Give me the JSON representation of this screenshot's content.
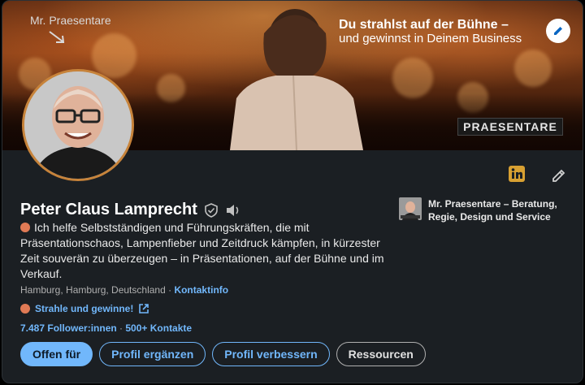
{
  "banner": {
    "brand_caption": "Mr. Praesentare",
    "headline": "Du strahlst auf der Bühne –",
    "subline": "und gewinnst in Deinem Business",
    "logo_text": "PRAESENTARE"
  },
  "profile": {
    "name": "Peter Claus Lamprecht",
    "headline": "Ich helfe Selbstständigen und Führungskräften, die mit Präsentationschaos, Lampenfieber und Zeitdruck kämpfen, in kürzester Zeit souverän zu überzeugen – in Präsentationen, auf der Bühne und im Verkauf.",
    "location": "Hamburg, Hamburg, Deutschland",
    "separator": " · ",
    "contact_link": "Kontaktinfo",
    "promo_link": "Strahle und gewinne!",
    "followers": "7.487 Follower:innen",
    "stats_separator": " · ",
    "connections": "500+ Kontakte"
  },
  "company": {
    "name": "Mr. Praesentare – Beratung, Regie, Design und Service"
  },
  "actions": {
    "open_to": "Offen für",
    "add_section": "Profil ergänzen",
    "enhance_profile": "Profil verbessern",
    "resources": "Ressourcen"
  },
  "colors": {
    "accent": "#71b7fb",
    "card_bg": "#1b1f23",
    "avatar_ring": "#c7833a",
    "dot": "#e07a55"
  },
  "icons": [
    "edit-banner-icon",
    "linkedin-icon",
    "edit-pencil-icon",
    "verified-shield-icon",
    "speaker-icon",
    "external-link-icon"
  ]
}
